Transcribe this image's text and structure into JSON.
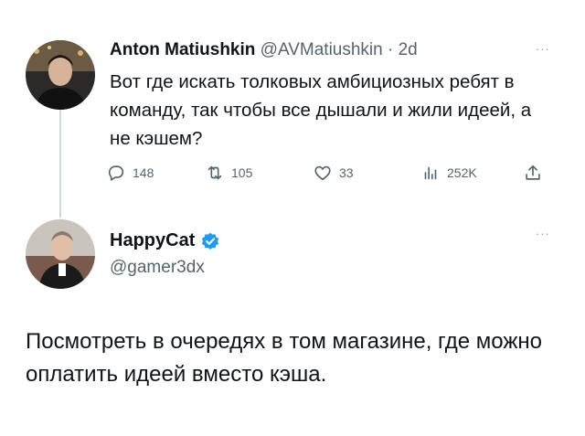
{
  "tweet1": {
    "name": "Anton Matiushkin",
    "handle": "@AVMatiushkin",
    "separator": " · ",
    "time": "2d",
    "text": "Вот где искать толковых амбициозных ребят в команду, так чтобы все дышали и жили идеей, а не кэшем?",
    "stats": {
      "replies": "148",
      "retweets": "105",
      "likes": "33",
      "views": "252K"
    }
  },
  "tweet2": {
    "name": "HappyCat",
    "handle": "@gamer3dx",
    "verified": true,
    "text": "Посмотреть в очередях в том магазине, где можно оплатить идеей вместо кэша."
  },
  "more_label": "···",
  "colors": {
    "text": "#0f1419",
    "secondary": "#536471",
    "verified": "#1d9bf0",
    "thread_line": "#cfd9de"
  }
}
